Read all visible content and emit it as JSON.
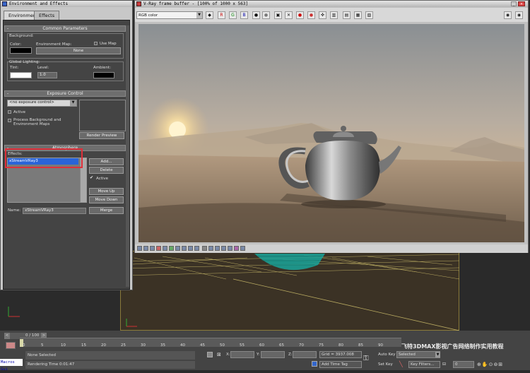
{
  "env_panel": {
    "title": "Environment and Effects",
    "tabs": [
      "Environment",
      "Effects"
    ],
    "common": {
      "header": "Common Parameters",
      "background_label": "Background:",
      "color_label": "Color:",
      "env_map_label": "Environment Map:",
      "use_map_label": "Use Map",
      "env_map_value": "None",
      "global_lighting_label": "Global Lighting:",
      "tint_label": "Tint:",
      "level_label": "Level:",
      "level_value": "1.0",
      "ambient_label": "Ambient:"
    },
    "exposure": {
      "header": "Exposure Control",
      "dropdown_value": "<no exposure control>",
      "active_label": "Active",
      "process_label": "Process Background and Environment Maps",
      "render_preview_label": "Render Preview"
    },
    "atmosphere": {
      "header": "Atmosphere",
      "effects_label": "Effects:",
      "effects_list": [
        "xStreamVRay3"
      ],
      "add_label": "Add...",
      "delete_label": "Delete",
      "active_label": "Active",
      "move_up_label": "Move Up",
      "move_down_label": "Move Down",
      "name_label": "Name:",
      "name_value": "xStreamVRay3",
      "merge_label": "Merge"
    }
  },
  "vfb": {
    "title": "V-Ray frame buffer - [100% of 1000 x 563]",
    "channel_value": "RGB color",
    "btn_r": "R",
    "btn_g": "G",
    "btn_b": "B"
  },
  "status": {
    "frame_counter": "0 / 100",
    "ticks": [
      "0",
      "5",
      "10",
      "15",
      "20",
      "25",
      "30",
      "35",
      "40",
      "45",
      "50",
      "55",
      "60",
      "65",
      "70",
      "75",
      "80",
      "85",
      "90"
    ],
    "selection": "None Selected",
    "render_time": "Rendering Time  0:01:47",
    "x_label": "X:",
    "y_label": "Y:",
    "z_label": "Z:",
    "grid": "Grid = 3937.008",
    "add_time_tag": "Add Time Tag",
    "auto_key": "Auto Key",
    "selected_dropdown": "Selected",
    "set_key": "Set Key",
    "key_filters": "Key Filters...",
    "frame_value": "0",
    "watermark": "飞特3DMAX影视广告网络制作实用教程",
    "macro_label": "Macros Gui"
  },
  "colors": {
    "highlight": "#e0303a",
    "list_select": "#2a64d8"
  }
}
